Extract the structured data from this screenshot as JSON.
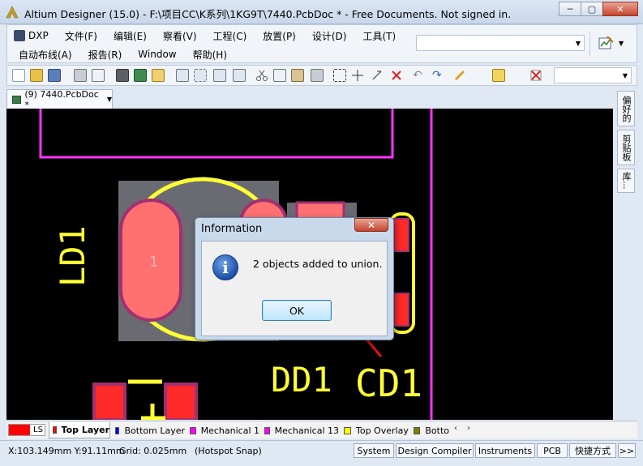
{
  "window": {
    "title": "Altium Designer (15.0) - F:\\项目CC\\K系列\\1KG9T\\7440.PcbDoc * - Free Documents. Not signed in.",
    "controls": {
      "minimize": "─",
      "maximize": "▢",
      "close": "✕"
    }
  },
  "menu": {
    "row1": [
      "DXP",
      "文件(F)",
      "编辑(E)",
      "察看(V)",
      "工程(C)",
      "放置(P)",
      "设计(D)",
      "工具(T)"
    ],
    "row2": [
      "自动布线(A)",
      "报告(R)",
      "Window",
      "帮助(H)"
    ]
  },
  "document_tab": {
    "label": "(9) 7440.PcbDoc *"
  },
  "right_panel": {
    "tabs": [
      "偏好的",
      "剪贴板",
      "库..."
    ]
  },
  "canvas": {
    "labels": {
      "ld1": "LD1",
      "dd1": "DD1",
      "cd1": "CD1",
      "pad1": "1"
    },
    "colors": {
      "background": "#000000",
      "track": "#ff33ff",
      "overlay": "#ffff00",
      "pad": "#ff7070"
    }
  },
  "dialog": {
    "title": "Information",
    "close": "✕",
    "message": "2 objects added to union.",
    "ok_label": "OK"
  },
  "layers": {
    "ls_label": "LS",
    "tabs": [
      {
        "name": "Top Layer",
        "color": "#ff0000",
        "active": true
      },
      {
        "name": "Bottom Layer",
        "color": "#0000ff",
        "active": false
      },
      {
        "name": "Mechanical 1",
        "color": "#ff00ff",
        "active": false
      },
      {
        "name": "Mechanical 13",
        "color": "#ff00ff",
        "active": false
      },
      {
        "name": "Top Overlay",
        "color": "#ffff00",
        "active": false
      },
      {
        "name": "Botto",
        "color": "#808000",
        "active": false
      }
    ],
    "nav_left": "‹",
    "nav_right": "›"
  },
  "status": {
    "coords": "X:103.149mm Y:91.11mm",
    "grid": "Grid: 0.025mm",
    "snap": "(Hotspot Snap)",
    "buttons": [
      "System",
      "Design Compiler",
      "Instruments",
      "PCB",
      "快捷方式",
      ">>"
    ]
  }
}
